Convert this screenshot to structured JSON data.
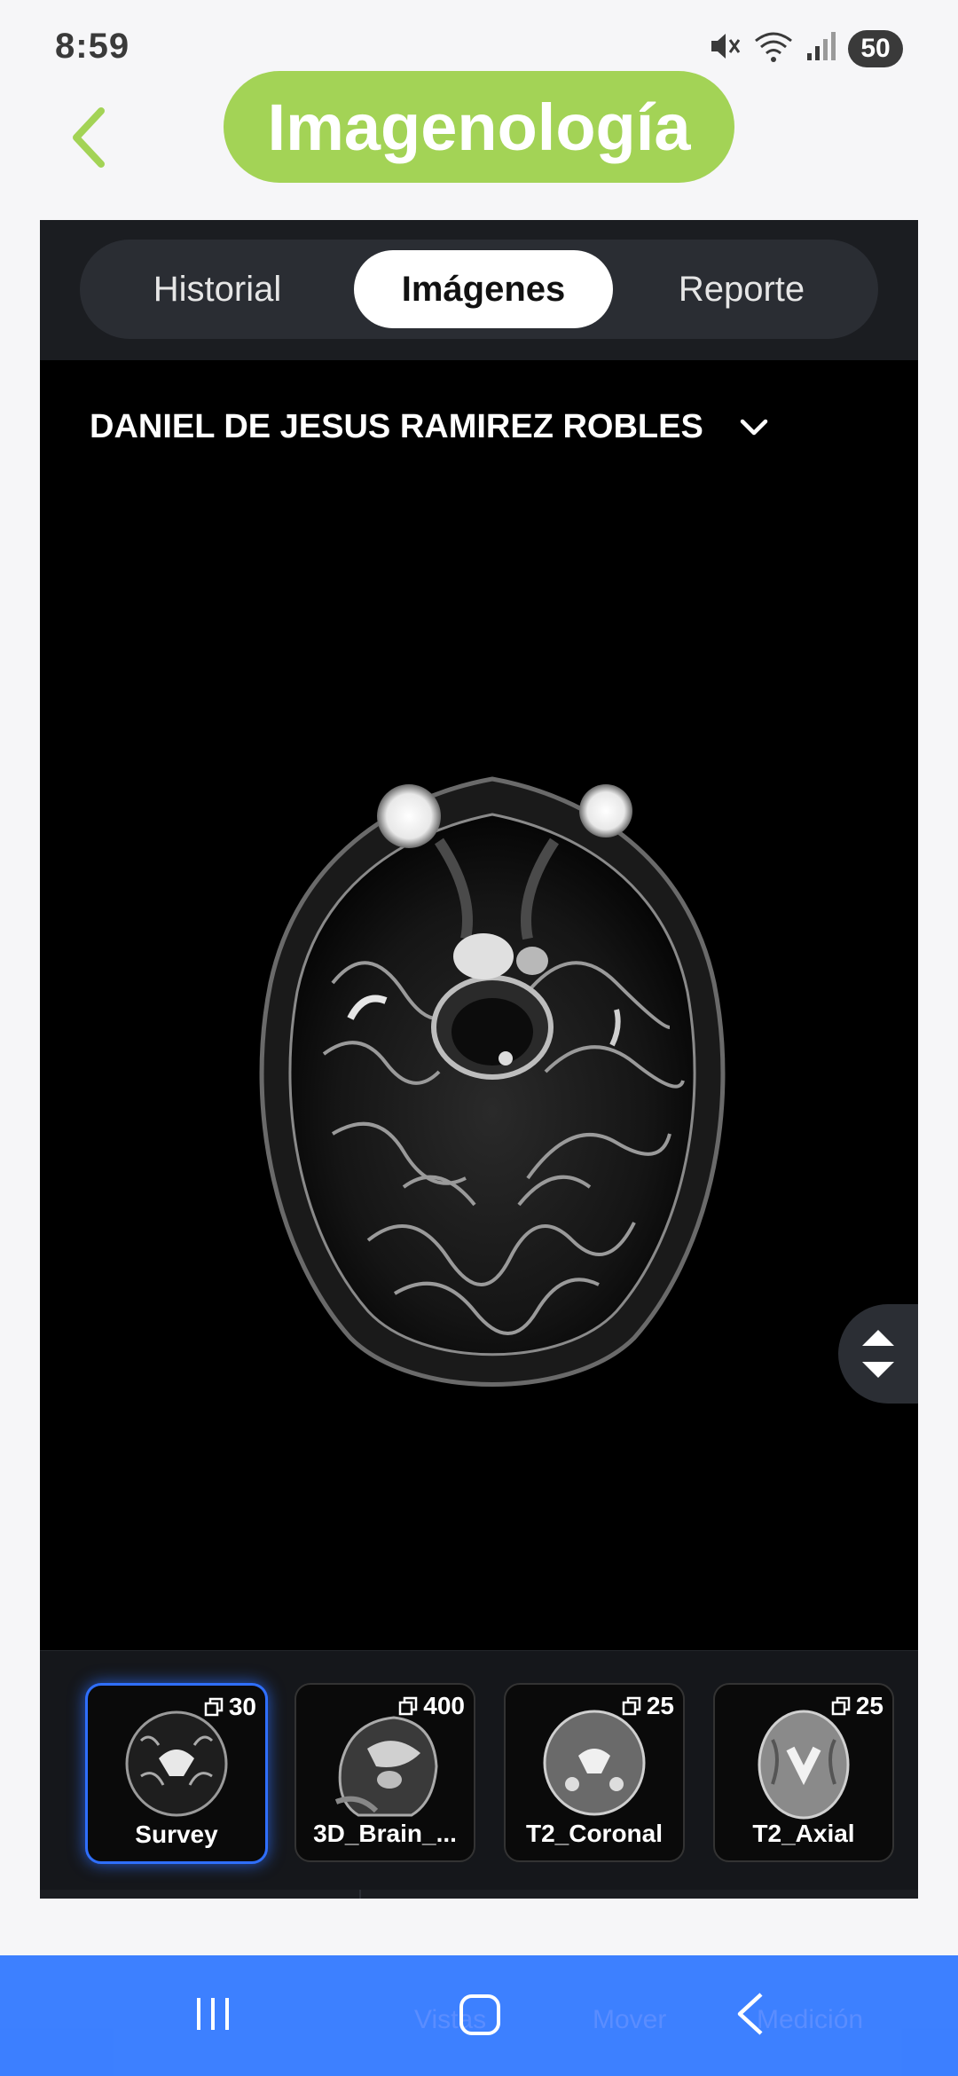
{
  "status_bar": {
    "time": "8:59",
    "battery": "50"
  },
  "header": {
    "title": "Imagenología"
  },
  "tabs": [
    {
      "label": "Historial",
      "active": false
    },
    {
      "label": "Imágenes",
      "active": true
    },
    {
      "label": "Reporte",
      "active": false
    }
  ],
  "patient": {
    "name": "DANIEL DE JESUS RAMIREZ ROBLES"
  },
  "series": [
    {
      "name": "Survey",
      "count": "30",
      "selected": true
    },
    {
      "name": "3D_Brain_...",
      "count": "400",
      "selected": false
    },
    {
      "name": "T2_Coronal",
      "count": "25",
      "selected": false
    },
    {
      "name": "T2_Axial",
      "count": "25",
      "selected": false
    }
  ],
  "toolbar": {
    "vistas": "Vistas",
    "mover": "Mover",
    "medicion": "Medición"
  },
  "colors": {
    "accent": "#a3d356",
    "selection": "#2f6fff",
    "nav": "#2e76ff"
  }
}
